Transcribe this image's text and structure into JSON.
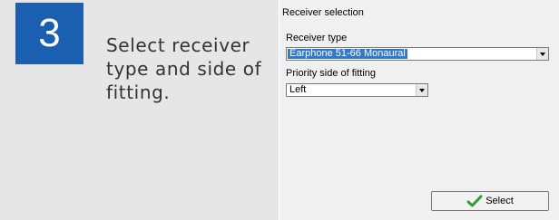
{
  "step": {
    "number": "3",
    "instruction": "Select receiver type and side of fitting."
  },
  "dialog": {
    "title": "Receiver selection",
    "receiver_type_label": "Receiver type",
    "receiver_type_value": "Earphone 51-66 Monaural",
    "priority_side_label": "Priority side of fitting",
    "priority_side_value": "Left",
    "select_button_label": "Select",
    "select_button_icon": "check-icon"
  },
  "colors": {
    "step_badge": "#1a5fb0",
    "step_panel": "#e6e6e6",
    "selection_highlight": "#3178c6",
    "check_icon": "#2f9e2f"
  }
}
